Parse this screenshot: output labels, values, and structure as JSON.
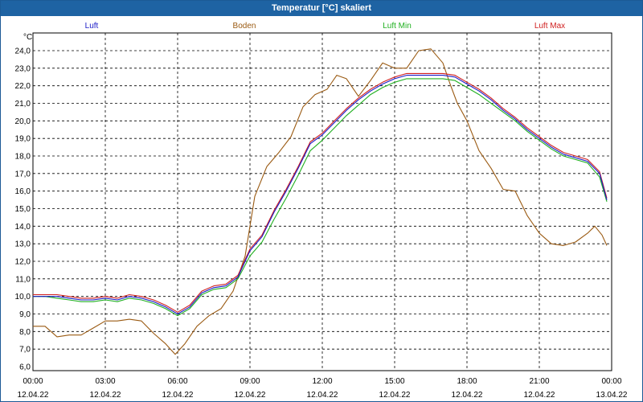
{
  "window": {
    "title": "Temperatur [°C] skaliert"
  },
  "chart_data": {
    "type": "line",
    "title": "Temperatur [°C] skaliert",
    "unit": "°C",
    "grid": true,
    "legend_placement": "top",
    "ylim": [
      6.0,
      24.0
    ],
    "yticks": [
      "6,0",
      "7,0",
      "8,0",
      "9,0",
      "10,0",
      "11,0",
      "12,0",
      "13,0",
      "14,0",
      "15,0",
      "16,0",
      "17,0",
      "18,0",
      "19,0",
      "20,0",
      "21,0",
      "22,0",
      "23,0",
      "24,0"
    ],
    "xlim_hours": [
      0,
      24
    ],
    "xticks": [
      {
        "time": "00:00",
        "date": "12.04.22"
      },
      {
        "time": "03:00",
        "date": "12.04.22"
      },
      {
        "time": "06:00",
        "date": "12.04.22"
      },
      {
        "time": "09:00",
        "date": "12.04.22"
      },
      {
        "time": "12:00",
        "date": "12.04.22"
      },
      {
        "time": "15:00",
        "date": "12.04.22"
      },
      {
        "time": "18:00",
        "date": "12.04.22"
      },
      {
        "time": "21:00",
        "date": "12.04.22"
      },
      {
        "time": "00:00",
        "date": "13.04.22"
      }
    ],
    "series": [
      {
        "name": "Luft",
        "color": "#1c1cc8",
        "x": [
          0,
          0.5,
          1,
          1.5,
          2,
          2.5,
          3,
          3.5,
          4,
          4.5,
          5,
          5.5,
          6,
          6.5,
          7,
          7.5,
          8,
          8.5,
          9,
          9.5,
          10,
          10.5,
          11,
          11.5,
          12,
          12.5,
          13,
          13.5,
          14,
          14.5,
          15,
          15.5,
          16,
          16.5,
          17,
          17.5,
          18,
          18.5,
          19,
          19.5,
          20,
          20.5,
          21,
          21.5,
          22,
          22.5,
          23,
          23.5,
          23.8
        ],
        "y": [
          10.0,
          10.0,
          10.0,
          9.9,
          9.8,
          9.8,
          9.9,
          9.8,
          10.0,
          9.9,
          9.7,
          9.4,
          9.0,
          9.4,
          10.2,
          10.5,
          10.6,
          11.1,
          12.6,
          13.4,
          14.8,
          16.0,
          17.3,
          18.7,
          19.2,
          19.9,
          20.6,
          21.2,
          21.7,
          22.1,
          22.4,
          22.6,
          22.6,
          22.6,
          22.6,
          22.5,
          22.1,
          21.7,
          21.2,
          20.6,
          20.1,
          19.5,
          19.0,
          18.5,
          18.1,
          17.9,
          17.7,
          17.0,
          15.5
        ]
      },
      {
        "name": "Boden",
        "color": "#9a5a12",
        "x": [
          0,
          0.5,
          1,
          1.5,
          2,
          2.5,
          3,
          3.5,
          4,
          4.5,
          5,
          5.5,
          5.9,
          6.3,
          6.8,
          7.3,
          7.8,
          8.3,
          8.8,
          9.2,
          9.7,
          10.2,
          10.7,
          11.2,
          11.7,
          12.2,
          12.6,
          13,
          13.5,
          14,
          14.5,
          15,
          15.5,
          16,
          16.5,
          17,
          17.3,
          17.6,
          18,
          18.5,
          19,
          19.5,
          20,
          20.5,
          21,
          21.5,
          22,
          22.5,
          23,
          23.3,
          23.6,
          23.8
        ],
        "y": [
          8.3,
          8.3,
          7.7,
          7.8,
          7.8,
          8.2,
          8.6,
          8.6,
          8.7,
          8.6,
          7.9,
          7.3,
          6.7,
          7.3,
          8.3,
          8.9,
          9.3,
          10.3,
          12.3,
          15.7,
          17.4,
          18.2,
          19.1,
          20.8,
          21.5,
          21.8,
          22.6,
          22.4,
          21.4,
          22.3,
          23.3,
          23.0,
          23.0,
          24.0,
          24.1,
          23.3,
          22.1,
          21.0,
          20.0,
          18.3,
          17.3,
          16.1,
          16.0,
          14.6,
          13.6,
          13.0,
          12.9,
          13.1,
          13.6,
          14.0,
          13.5,
          12.9
        ]
      },
      {
        "name": "Luft Min",
        "color": "#20b020",
        "x": [
          0,
          0.5,
          1,
          1.5,
          2,
          2.5,
          3,
          3.5,
          4,
          4.5,
          5,
          5.5,
          6,
          6.5,
          7,
          7.5,
          8,
          8.5,
          9,
          9.5,
          10,
          10.5,
          11,
          11.5,
          12,
          12.5,
          13,
          13.5,
          14,
          14.5,
          15,
          15.5,
          16,
          16.5,
          17,
          17.5,
          18,
          18.5,
          19,
          19.5,
          20,
          20.5,
          21,
          21.5,
          22,
          22.5,
          23,
          23.5,
          23.8
        ],
        "y": [
          10.0,
          10.0,
          9.9,
          9.8,
          9.7,
          9.7,
          9.8,
          9.7,
          9.9,
          9.8,
          9.6,
          9.3,
          8.9,
          9.3,
          10.1,
          10.4,
          10.5,
          11.0,
          12.3,
          13.1,
          14.4,
          15.6,
          16.9,
          18.3,
          18.9,
          19.6,
          20.3,
          20.9,
          21.5,
          21.9,
          22.2,
          22.4,
          22.4,
          22.4,
          22.4,
          22.3,
          21.9,
          21.5,
          21.0,
          20.5,
          20.0,
          19.4,
          18.9,
          18.4,
          18.0,
          17.8,
          17.6,
          16.8,
          15.4
        ]
      },
      {
        "name": "Luft Max",
        "color": "#d02020",
        "x": [
          0,
          0.5,
          1,
          1.5,
          2,
          2.5,
          3,
          3.5,
          4,
          4.5,
          5,
          5.5,
          6,
          6.5,
          7,
          7.5,
          8,
          8.5,
          9,
          9.5,
          10,
          10.5,
          11,
          11.5,
          12,
          12.5,
          13,
          13.5,
          14,
          14.5,
          15,
          15.5,
          16,
          16.5,
          17,
          17.5,
          18,
          18.5,
          19,
          19.5,
          20,
          20.5,
          21,
          21.5,
          22,
          22.5,
          23,
          23.5,
          23.8
        ],
        "y": [
          10.1,
          10.1,
          10.1,
          10.0,
          9.9,
          9.9,
          10.0,
          9.9,
          10.1,
          10.0,
          9.8,
          9.5,
          9.1,
          9.5,
          10.3,
          10.6,
          10.7,
          11.2,
          12.7,
          13.5,
          14.9,
          16.1,
          17.4,
          18.8,
          19.3,
          20.0,
          20.7,
          21.3,
          21.8,
          22.2,
          22.5,
          22.7,
          22.7,
          22.7,
          22.7,
          22.6,
          22.2,
          21.8,
          21.3,
          20.7,
          20.2,
          19.6,
          19.1,
          18.6,
          18.2,
          18.0,
          17.8,
          17.1,
          15.6
        ]
      }
    ]
  }
}
